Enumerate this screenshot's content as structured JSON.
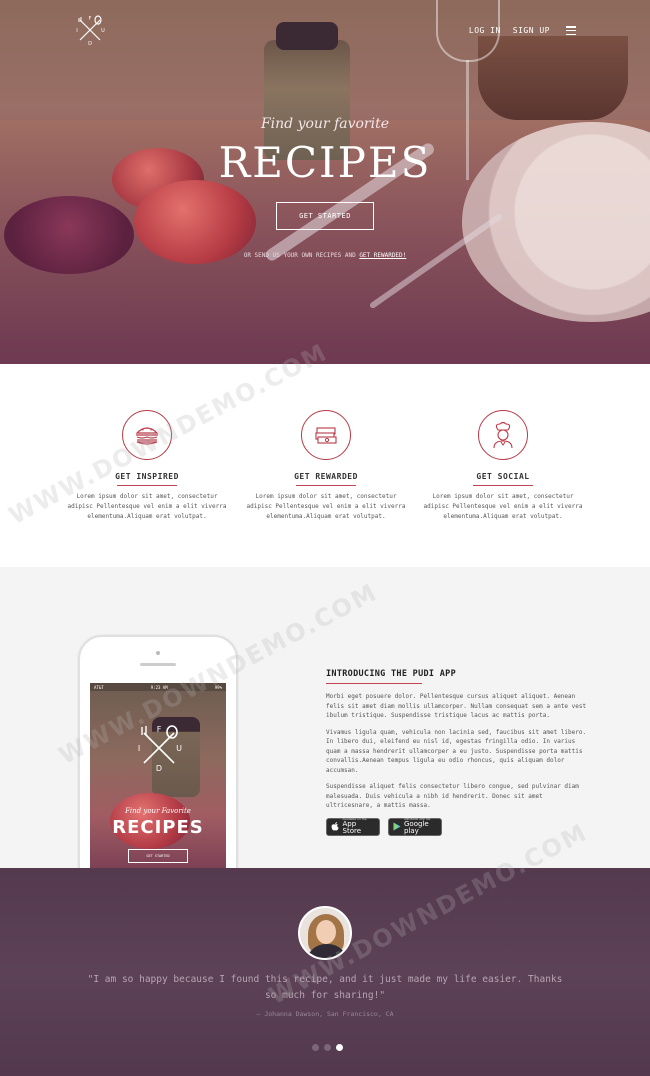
{
  "nav": {
    "login": "LOG IN",
    "signup": "SIGN UP",
    "menu_icon": "hamburger-icon"
  },
  "hero": {
    "subtitle": "Find your favorite",
    "title": "RECIPES",
    "cta": "GET STARTED",
    "note_prefix": "OR SEND US YOUR OWN RECIPES AND ",
    "note_link": "GET REWARDED!"
  },
  "features": [
    {
      "icon": "burger-icon",
      "title": "GET INSPIRED",
      "text": "Lorem ipsum dolor sit amet, consectetur adipisc Pellentesque vel enim a elit viverra elementuma.Aliquam erat volutpat."
    },
    {
      "icon": "money-stack-icon",
      "title": "GET REWARDED",
      "text": "Lorem ipsum dolor sit amet, consectetur adipisc Pellentesque vel enim a elit viverra elementuma.Aliquam erat volutpat."
    },
    {
      "icon": "chef-icon",
      "title": "GET SOCIAL",
      "text": "Lorem ipsum dolor sit amet, consectetur adipisc Pellentesque vel enim a elit viverra elementuma.Aliquam erat volutpat."
    }
  ],
  "app": {
    "heading": "INTRODUCING THE PUDI APP",
    "paragraphs": [
      "Morbi eget posuere dolor. Pellentesque cursus aliquet aliquet. Aenean felis sit amet diam mollis ullamcorper. Nullam consequat sem a ante vest ibulum tristique. Suspendisse tristique lacus ac mattis porta.",
      "Vivamus ligula quam, vehicula non lacinia sed, faucibus sit amet libero. In libero dui, eleifend eu nisl id, egestas fringilla odio. In varius quam a massa hendrerit ullamcorper a eu justo. Suspendisse porta mattis convallis.Aenean tempus ligula eu odio rhoncus, quis aliquam dolor accumsan.",
      "Suspendisse aliquet felis consectetur libero congue, sed pulvinar diam malesuada. Duis vehicula a nibh id hendrerit. Donec sit amet ultricesnare, a mattis massa."
    ],
    "appstore": {
      "small": "Available on the",
      "big": "App Store"
    },
    "googleplay": {
      "small": "ANDROID APP ON",
      "big": "Google play"
    },
    "phone": {
      "carrier": "AT&T",
      "time": "9:23 AM",
      "battery": "99%",
      "logo_letters": [
        "F",
        "I",
        "U",
        "D"
      ],
      "subtitle": "Find your Favorite",
      "title": "RECIPES",
      "cta": "GET STARTED"
    }
  },
  "testimonial": {
    "quote": "\"I am so happy because I found this recipe, and it just made my life easier. Thanks so much for sharing!\"",
    "author": "— Johanna Dawson, San Francisco, CA"
  },
  "logo": {
    "letters": [
      "F",
      "I",
      "U",
      "D"
    ]
  },
  "watermark": "WWW.DOWNDEMO.COM",
  "colors": {
    "accent": "#c24555",
    "hero_overlay": "#8a5763",
    "testimonial_bg": "#5d4257"
  }
}
